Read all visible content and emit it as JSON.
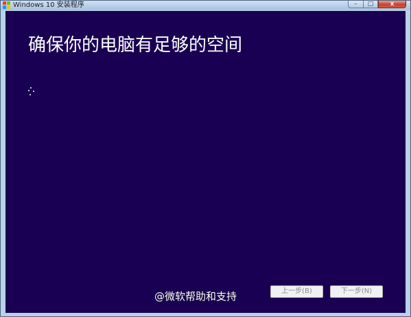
{
  "window": {
    "title": "Windows 10 安装程序",
    "icon": "windows-setup-icon",
    "caption_buttons": {
      "minimize_glyph": "–",
      "maximize_glyph": "□",
      "close_glyph": "x"
    }
  },
  "main": {
    "heading": "确保你的电脑有足够的空间",
    "status_icon": "loading-spinner-icon"
  },
  "buttons": {
    "back_label": "上一步(B)",
    "next_label": "下一步(N)"
  },
  "watermark": {
    "text": "@微软帮助和支持"
  },
  "colors": {
    "background": "#1a0052",
    "text": "#ffffff",
    "titlebar": "#b9d1ea"
  }
}
